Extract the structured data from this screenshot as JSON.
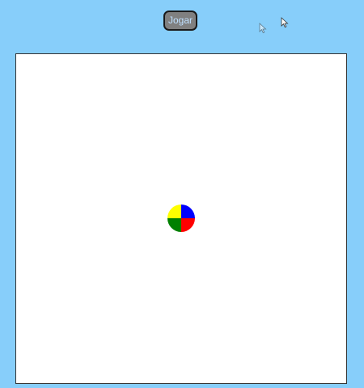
{
  "toolbar": {
    "play_label": "Jogar"
  },
  "board": {
    "background": "#ffffff",
    "border": "#333333"
  },
  "ball": {
    "quadrants": {
      "top_left": "#ffff00",
      "top_right": "#0000ff",
      "bottom_left": "#008000",
      "bottom_right": "#ff0000"
    }
  },
  "colors": {
    "page_background": "#87cefa",
    "button_background": "#808080",
    "button_text": "#bfe0ff"
  },
  "icons": {
    "cursor": "mouse-pointer-icon"
  }
}
